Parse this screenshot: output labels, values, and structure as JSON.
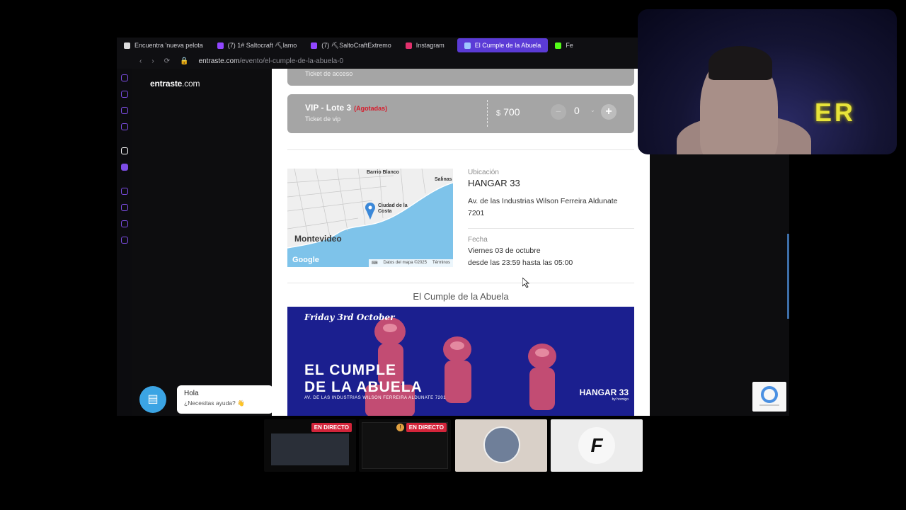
{
  "browser": {
    "tabs": [
      {
        "label": "Encuentra 'nueva pelota"
      },
      {
        "label": "(7) 1# Saltocraft ⛏lamo"
      },
      {
        "label": "(7) ⛏SaltoCraftExtremo"
      },
      {
        "label": "Instagram"
      },
      {
        "label": "El Cumple de la Abuela"
      },
      {
        "label": "Fe"
      }
    ],
    "url_host": "entraste.com",
    "url_path": "/evento/el-cumple-de-la-abuela-0"
  },
  "site": {
    "logo_main": "entraste",
    "logo_domain": ".com"
  },
  "tickets": [
    {
      "desc": "Ticket de acceso"
    },
    {
      "name": "VIP - Lote 3",
      "status": "(Agotadas)",
      "desc": "Ticket de vip",
      "currency": "$",
      "price": "700",
      "qty": "0",
      "minus": "−",
      "plus": "+"
    }
  ],
  "map": {
    "labels": [
      "Barrio Blanco",
      "Ciudad de la Costa",
      "Salinas"
    ],
    "city": "Montevideo",
    "brand": "Google",
    "attribution": "Datos del mapa ©2025",
    "terms": "Términos"
  },
  "location": {
    "label": "Ubicación",
    "venue": "HANGAR 33",
    "address": "Av. de las Industrias Wilson Ferreira Aldunate 7201"
  },
  "date": {
    "label": "Fecha",
    "day": "Viernes 03 de octubre",
    "time": "desde las 23:59 hasta las 05:00"
  },
  "event": {
    "title": "El Cumple de la Abuela",
    "banner_date": "Friday 3rd October",
    "banner_line1": "EL CUMPLE",
    "banner_line2": "DE LA ABUELA",
    "banner_sub": "AV. DE LAS INDUSTRIAS WILSON FERREIRA ALDUNATE 7201",
    "banner_venue": "HANGAR 33",
    "banner_venue_sub": "by hornigo"
  },
  "chat": {
    "greeting": "Hola",
    "prompt": "¿Necesitas ayuda? 👋"
  },
  "stream": {
    "live_label": "EN DIRECTO",
    "overlay_text": "ER",
    "letter_thumb": "F"
  },
  "colors": {
    "accent": "#5b3bd6",
    "soldout": "#d61c2c",
    "chat": "#3ba4e4",
    "banner": "#1b1f8f"
  }
}
